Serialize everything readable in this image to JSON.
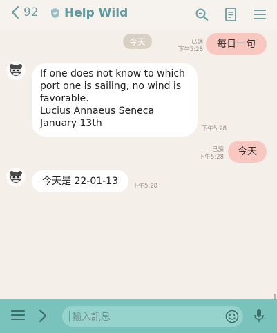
{
  "header": {
    "back_count": "92",
    "title": "Help Wild",
    "icons": [
      "search-icon",
      "note-icon",
      "menu-icon"
    ]
  },
  "messages": {
    "date_chip": "今天",
    "m1": {
      "text": "每日一句",
      "read": "已讀",
      "time": "下午5:28",
      "direction": "out"
    },
    "m2": {
      "lines": [
        "If one does not know to which",
        "port one is sailing, no wind is",
        "favorable.",
        "Lucius Annaeus Seneca",
        "January 13th"
      ],
      "time": "下午5:28",
      "direction": "in"
    },
    "m3": {
      "text": "今天",
      "read": "已讀",
      "time": "下午5:28",
      "direction": "out"
    },
    "m4": {
      "text": "今天是 22-01-13",
      "time": "下午5:28",
      "direction": "in"
    }
  },
  "footer": {
    "placeholder": "輸入訊息",
    "icons": [
      "hamburger-menu-icon",
      "chevron-right-icon",
      "emoji-icon",
      "microphone-icon"
    ]
  },
  "colors": {
    "accent": "#5f9aa0",
    "outgoing_bubble": "#f8c8c0",
    "incoming_bubble": "#ffffff",
    "footer_bar": "#7ac3bd"
  }
}
